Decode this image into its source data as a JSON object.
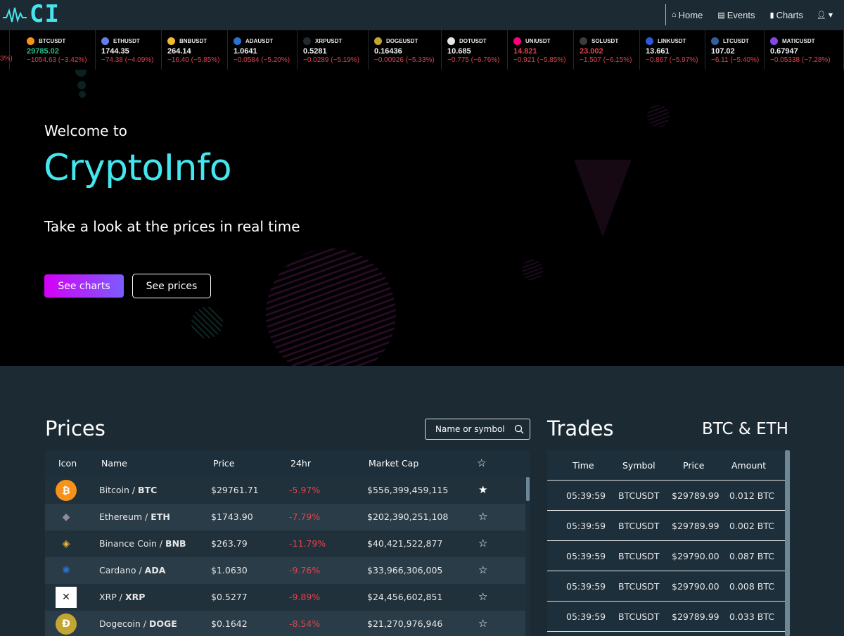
{
  "brand": {
    "logo_text": "CI"
  },
  "nav": {
    "home": "Home",
    "events": "Events",
    "charts": "Charts"
  },
  "ticker": [
    {
      "symbol": "BTCUSDT",
      "price": "29785.02",
      "change": "−1054.63 (−3.42%)",
      "price_color": "green",
      "coin_color": "#f7931a"
    },
    {
      "symbol": "ETHUSDT",
      "price": "1744.35",
      "change": "−74.38 (−4.09%)",
      "price_color": "white",
      "coin_color": "#627eea"
    },
    {
      "symbol": "BNBUSDT",
      "price": "264.14",
      "change": "−16.40 (−5.85%)",
      "price_color": "white",
      "coin_color": "#f3ba2f"
    },
    {
      "symbol": "ADAUSDT",
      "price": "1.0641",
      "change": "−0.0584 (−5.20%)",
      "price_color": "white",
      "coin_color": "#2a71d0"
    },
    {
      "symbol": "XRPUSDT",
      "price": "0.5281",
      "change": "−0.0289 (−5.19%)",
      "price_color": "white",
      "coin_color": "#23292f"
    },
    {
      "symbol": "DOGEUSDT",
      "price": "0.16436",
      "change": "−0.00926 (−5.33%)",
      "price_color": "white",
      "coin_color": "#c2a633"
    },
    {
      "symbol": "DOTUSDT",
      "price": "10.685",
      "change": "−0.775 (−6.76%)",
      "price_color": "white",
      "coin_color": "#e6e6e6"
    },
    {
      "symbol": "UNIUSDT",
      "price": "14.821",
      "change": "−0.921 (−5.85%)",
      "price_color": "red",
      "coin_color": "#ff007a"
    },
    {
      "symbol": "SOLUSDT",
      "price": "23.002",
      "change": "−1.507 (−6.15%)",
      "price_color": "red",
      "coin_color": "#3c3c3d"
    },
    {
      "symbol": "LINKUSDT",
      "price": "13.661",
      "change": "−0.867 (−5.97%)",
      "price_color": "white",
      "coin_color": "#2a5ada"
    },
    {
      "symbol": "LTCUSDT",
      "price": "107.02",
      "change": "−6.11 (−5.40%)",
      "price_color": "white",
      "coin_color": "#345d9d"
    },
    {
      "symbol": "MATICUSDT",
      "price": "0.67947",
      "change": "−0.05338 (−7.28%)",
      "price_color": "white",
      "coin_color": "#8247e5"
    }
  ],
  "ticker_partial_change": "3%)",
  "hero": {
    "welcome": "Welcome to",
    "brand": "CryptoInfo",
    "tagline": "Take a look at the prices in real time",
    "btn_charts": "See charts",
    "btn_prices": "See prices"
  },
  "prices": {
    "title": "Prices",
    "search_placeholder": "Name or symbol",
    "columns": {
      "icon": "Icon",
      "name": "Name",
      "price": "Price",
      "change": "24hr",
      "cap": "Market Cap"
    },
    "rows": [
      {
        "name": "Bitcoin",
        "symbol": "BTC",
        "price": "$29761.71",
        "change": "-5.97%",
        "cap": "$556,399,459,115",
        "star": "★",
        "icon_color": "#f7931a",
        "icon_glyph": "₿"
      },
      {
        "name": "Ethereum",
        "symbol": "ETH",
        "price": "$1743.90",
        "change": "-7.79%",
        "cap": "$202,390,251,108",
        "star": "☆",
        "icon_color": "#2a3c47",
        "icon_glyph": "◆"
      },
      {
        "name": "Binance Coin",
        "symbol": "BNB",
        "price": "$263.79",
        "change": "-11.79%",
        "cap": "$40,421,522,877",
        "star": "☆",
        "icon_color": "#21313b",
        "icon_glyph": "◈"
      },
      {
        "name": "Cardano",
        "symbol": "ADA",
        "price": "$1.0630",
        "change": "-9.76%",
        "cap": "$33,966,306,005",
        "star": "☆",
        "icon_color": "#2a3c47",
        "icon_glyph": "✺"
      },
      {
        "name": "XRP",
        "symbol": "XRP",
        "price": "$0.5277",
        "change": "-9.89%",
        "cap": "$24,456,602,851",
        "star": "☆",
        "icon_color": "#ffffff",
        "icon_glyph": "✕"
      },
      {
        "name": "Dogecoin",
        "symbol": "DOGE",
        "price": "$0.1642",
        "change": "-8.54%",
        "cap": "$21,270,976,946",
        "star": "☆",
        "icon_color": "#c2a633",
        "icon_glyph": "Ð"
      }
    ]
  },
  "trades": {
    "title": "Trades",
    "subtitle": "BTC & ETH",
    "columns": {
      "time": "Time",
      "symbol": "Symbol",
      "price": "Price",
      "amount": "Amount"
    },
    "rows": [
      {
        "time": "05:39:59",
        "symbol": "BTCUSDT",
        "price": "$29789.99",
        "amount": "0.012 BTC"
      },
      {
        "time": "05:39:59",
        "symbol": "BTCUSDT",
        "price": "$29789.99",
        "amount": "0.002 BTC"
      },
      {
        "time": "05:39:59",
        "symbol": "BTCUSDT",
        "price": "$29790.00",
        "amount": "0.087 BTC"
      },
      {
        "time": "05:39:59",
        "symbol": "BTCUSDT",
        "price": "$29790.00",
        "amount": "0.008 BTC"
      },
      {
        "time": "05:39:59",
        "symbol": "BTCUSDT",
        "price": "$29789.99",
        "amount": "0.033 BTC"
      }
    ]
  }
}
